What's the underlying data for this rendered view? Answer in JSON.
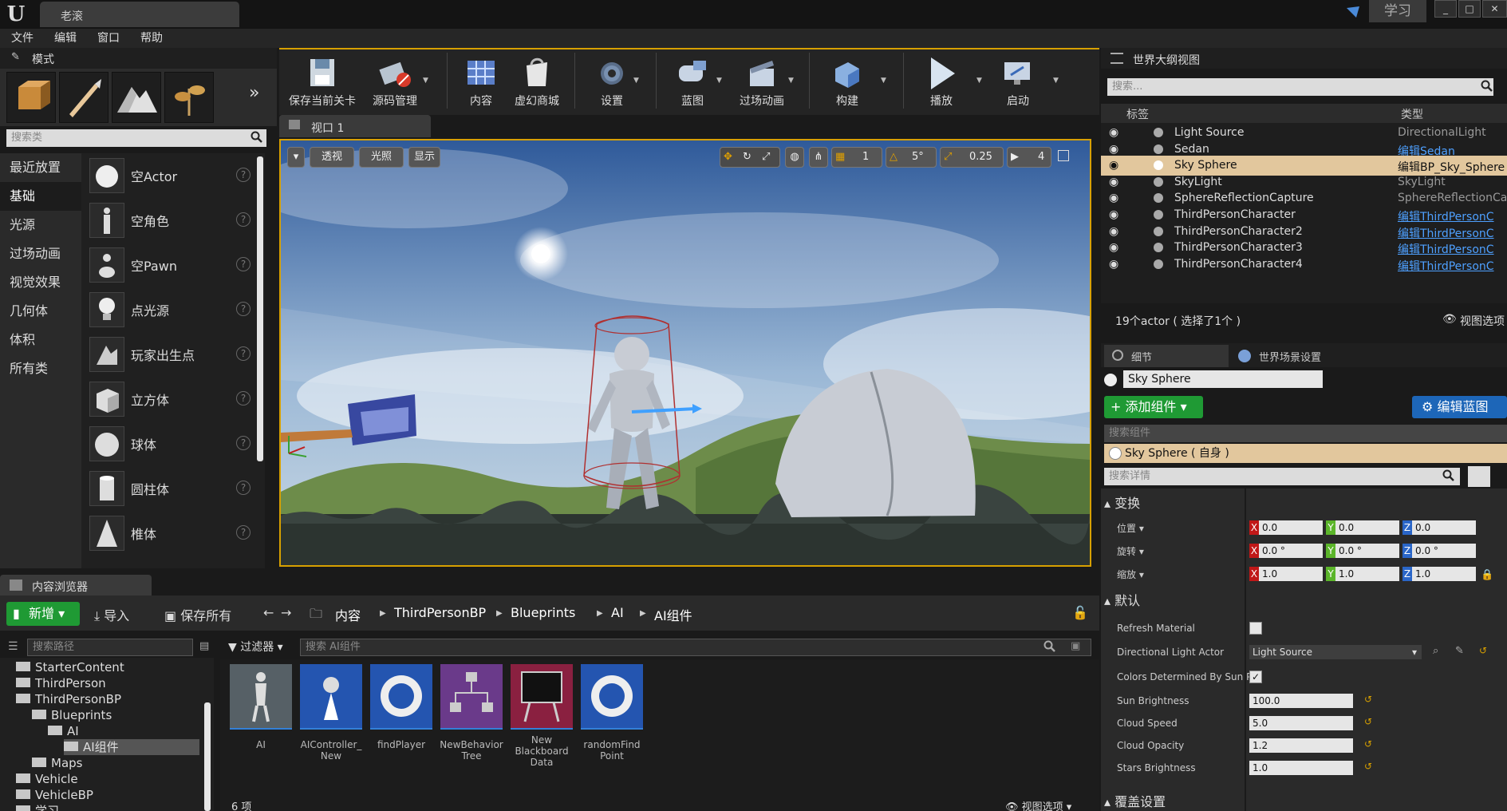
{
  "app": {
    "tab_title": "老滚",
    "learn": "学习"
  },
  "menu": [
    "文件",
    "编辑",
    "窗口",
    "帮助"
  ],
  "modes": {
    "title": "模式",
    "search_placeholder": "搜索类",
    "categories": [
      "最近放置",
      "基础",
      "光源",
      "过场动画",
      "视觉效果",
      "几何体",
      "体积",
      "所有类"
    ],
    "selected_category": "基础",
    "items": [
      "空Actor",
      "空角色",
      "空Pawn",
      "点光源",
      "玩家出生点",
      "立方体",
      "球体",
      "圆柱体",
      "椎体"
    ]
  },
  "toolbar": {
    "buttons": [
      "保存当前关卡",
      "源码管理",
      "内容",
      "虚幻商城",
      "设置",
      "蓝图",
      "过场动画",
      "构建",
      "播放",
      "启动"
    ]
  },
  "viewport": {
    "tab": "视口 1",
    "perspective": "透视",
    "lit": "光照",
    "show": "显示",
    "grid_value": "1",
    "angle_value": "5°",
    "scale_value": "0.25",
    "camera_speed": "4"
  },
  "outliner": {
    "title": "世界大纲视图",
    "search_placeholder": "搜索...",
    "col_label": "标签",
    "col_type": "类型",
    "rows": [
      {
        "name": "Light Source",
        "type": "DirectionalLight",
        "link": false
      },
      {
        "name": "Sedan",
        "type": "编辑Sedan",
        "link": true
      },
      {
        "name": "Sky Sphere",
        "type": "编辑BP_Sky_Sphere",
        "link": false
      },
      {
        "name": "SkyLight",
        "type": "SkyLight",
        "link": false
      },
      {
        "name": "SphereReflectionCapture",
        "type": "SphereReflectionCapture",
        "link": false
      },
      {
        "name": "ThirdPersonCharacter",
        "type": "编辑ThirdPersonC",
        "link": true
      },
      {
        "name": "ThirdPersonCharacter2",
        "type": "编辑ThirdPersonC",
        "link": true
      },
      {
        "name": "ThirdPersonCharacter3",
        "type": "编辑ThirdPersonC",
        "link": true
      },
      {
        "name": "ThirdPersonCharacter4",
        "type": "编辑ThirdPersonC",
        "link": true
      }
    ],
    "status": "19个actor ( 选择了1个 )",
    "view_options": "视图选项"
  },
  "details": {
    "tab_details": "细节",
    "tab_world": "世界场景设置",
    "actor_name": "Sky Sphere",
    "add_component": "添加组件",
    "edit_blueprint": "编辑蓝图",
    "comp_search": "搜索组件",
    "comp_self": "Sky Sphere ( 自身 )",
    "detail_search": "搜索详情",
    "transform": "变换",
    "location": "位置",
    "rotation": "旋转",
    "scale": "缩放",
    "loc": [
      "0.0",
      "0.0",
      "0.0"
    ],
    "rot": [
      "0.0 °",
      "0.0 °",
      "0.0 °"
    ],
    "scl": [
      "1.0",
      "1.0",
      "1.0"
    ],
    "default": "默认",
    "props": {
      "refresh": "Refresh Material",
      "dir_light": "Directional Light Actor",
      "dir_light_value": "Light Source",
      "colors": "Colors Determined By Sun P",
      "sun_brightness": "Sun Brightness",
      "sun_brightness_value": "100.0",
      "cloud_speed": "Cloud Speed",
      "cloud_speed_value": "5.0",
      "cloud_opacity": "Cloud Opacity",
      "cloud_opacity_value": "1.2",
      "stars": "Stars Brightness",
      "stars_value": "1.0"
    },
    "next_section": "覆盖设置"
  },
  "content": {
    "tab": "内容浏览器",
    "new": "新增",
    "import": "导入",
    "save_all": "保存所有",
    "crumbs": [
      "内容",
      "ThirdPersonBP",
      "Blueprints",
      "AI",
      "AI组件"
    ],
    "path_search": "搜索路径",
    "filters": "过滤器",
    "asset_search": "搜索 AI组件",
    "tree": [
      "StarterContent",
      "ThirdPerson",
      "ThirdPersonBP",
      "Blueprints",
      "AI",
      "AI组件",
      "Maps",
      "Vehicle",
      "VehicleBP",
      "学习"
    ],
    "assets": [
      {
        "line1": "AI",
        "line2": ""
      },
      {
        "line1": "AIController_",
        "line2": "New"
      },
      {
        "line1": "findPlayer",
        "line2": ""
      },
      {
        "line1": "NewBehavior",
        "line2": "Tree"
      },
      {
        "line1": "New Blackboard",
        "line2": "Data"
      },
      {
        "line1": "randomFind",
        "line2": "Point"
      }
    ],
    "count": "6 项",
    "view_options": "视图选项"
  }
}
